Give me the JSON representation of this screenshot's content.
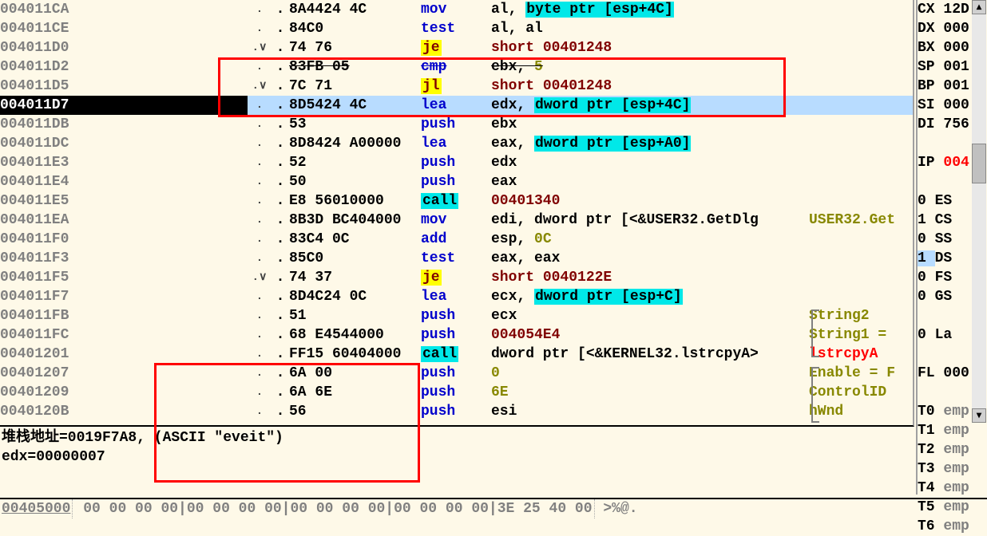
{
  "rows": [
    {
      "addr": "004011CA",
      "hint": ".",
      "bytes": "8A4424 4C",
      "mnem": "mov",
      "mnemCls": "tok-mnem-blue",
      "ops": [
        {
          "t": "al, ",
          "c": "tok-reg"
        },
        {
          "t": "byte ptr [esp+4C]",
          "c": "tok-ptr"
        }
      ]
    },
    {
      "addr": "004011CE",
      "hint": ".",
      "bytes": "84C0",
      "mnem": "test",
      "mnemCls": "tok-mnem-blue",
      "ops": [
        {
          "t": "al, al",
          "c": "tok-reg"
        }
      ]
    },
    {
      "addr": "004011D0",
      "hint": ".∨",
      "bytes": "74 76",
      "mnem": "je",
      "mnemCls": "tok-mnem-je",
      "ops": [
        {
          "t": "short ",
          "c": "tok-addr"
        },
        {
          "t": "00401248",
          "c": "tok-addr"
        }
      ]
    },
    {
      "addr": "004011D2",
      "hint": ".",
      "bytes": "83FB 05",
      "mnem": "cmp",
      "mnemCls": "tok-mnem-blue",
      "strike": true,
      "ops": [
        {
          "t": "ebx, ",
          "c": "tok-reg"
        },
        {
          "t": "5",
          "c": "tok-num"
        }
      ]
    },
    {
      "addr": "004011D5",
      "hint": ".∨",
      "bytes": "7C 71",
      "mnem": "jl",
      "mnemCls": "tok-mnem-je",
      "ops": [
        {
          "t": "short ",
          "c": "tok-addr"
        },
        {
          "t": "00401248",
          "c": "tok-addr"
        }
      ]
    },
    {
      "addr": "004011D7",
      "hint": ".",
      "bytes": "8D5424 4C",
      "mnem": "lea",
      "mnemCls": "tok-mnem-blue",
      "selected": true,
      "highlight": true,
      "ops": [
        {
          "t": "edx, ",
          "c": "tok-reg"
        },
        {
          "t": "dword ptr [esp+4C]",
          "c": "tok-ptr"
        }
      ]
    },
    {
      "addr": "004011DB",
      "hint": ".",
      "bytes": "53",
      "mnem": "push",
      "mnemCls": "tok-mnem-blue",
      "ops": [
        {
          "t": "ebx",
          "c": "tok-reg"
        }
      ]
    },
    {
      "addr": "004011DC",
      "hint": ".",
      "bytes": "8D8424 A00000",
      "mnem": "lea",
      "mnemCls": "tok-mnem-blue",
      "ops": [
        {
          "t": "eax, ",
          "c": "tok-reg"
        },
        {
          "t": "dword ptr [esp+A0]",
          "c": "tok-ptr"
        }
      ]
    },
    {
      "addr": "004011E3",
      "hint": ".",
      "bytes": "52",
      "mnem": "push",
      "mnemCls": "tok-mnem-blue",
      "ops": [
        {
          "t": "edx",
          "c": "tok-reg"
        }
      ]
    },
    {
      "addr": "004011E4",
      "hint": ".",
      "bytes": "50",
      "mnem": "push",
      "mnemCls": "tok-mnem-blue",
      "ops": [
        {
          "t": "eax",
          "c": "tok-reg"
        }
      ]
    },
    {
      "addr": "004011E5",
      "hint": ".",
      "bytes": "E8 56010000",
      "mnem": "call",
      "mnemCls": "tok-mnem-call",
      "ops": [
        {
          "t": "00401340",
          "c": "tok-addr"
        }
      ]
    },
    {
      "addr": "004011EA",
      "hint": ".",
      "bytes": "8B3D BC404000",
      "mnem": "mov",
      "mnemCls": "tok-mnem-blue",
      "ops": [
        {
          "t": "edi, ",
          "c": "tok-reg"
        },
        {
          "t": "dword ptr [<&USER32.GetDlg",
          "c": "tok-reg"
        }
      ],
      "cmt": "USER32.Get",
      "cmtCls": "cmt-normal"
    },
    {
      "addr": "004011F0",
      "hint": ".",
      "bytes": "83C4 0C",
      "mnem": "add",
      "mnemCls": "tok-mnem-blue",
      "ops": [
        {
          "t": "esp, ",
          "c": "tok-reg"
        },
        {
          "t": "0C",
          "c": "tok-num"
        }
      ]
    },
    {
      "addr": "004011F3",
      "hint": ".",
      "bytes": "85C0",
      "mnem": "test",
      "mnemCls": "tok-mnem-blue",
      "ops": [
        {
          "t": "eax, eax",
          "c": "tok-reg"
        }
      ]
    },
    {
      "addr": "004011F5",
      "hint": ".∨",
      "bytes": "74 37",
      "mnem": "je",
      "mnemCls": "tok-mnem-je",
      "ops": [
        {
          "t": "short ",
          "c": "tok-addr"
        },
        {
          "t": "0040122E",
          "c": "tok-addr"
        }
      ]
    },
    {
      "addr": "004011F7",
      "hint": ".",
      "bytes": "8D4C24 0C",
      "mnem": "lea",
      "mnemCls": "tok-mnem-blue",
      "ops": [
        {
          "t": "ecx, ",
          "c": "tok-reg"
        },
        {
          "t": "dword ptr [esp+C]",
          "c": "tok-ptr"
        }
      ]
    },
    {
      "addr": "004011FB",
      "hint": ".",
      "bytes": "51",
      "mnem": "push",
      "mnemCls": "tok-mnem-blue",
      "ops": [
        {
          "t": "ecx",
          "c": "tok-reg"
        }
      ],
      "cmt": "String2",
      "cmtCls": "cmt-normal"
    },
    {
      "addr": "004011FC",
      "hint": ".",
      "bytes": "68 E4544000",
      "mnem": "push",
      "mnemCls": "tok-mnem-blue",
      "ops": [
        {
          "t": "004054E4",
          "c": "tok-addr"
        }
      ],
      "cmt": "String1 =",
      "cmtCls": "cmt-normal"
    },
    {
      "addr": "00401201",
      "hint": ".",
      "bytes": "FF15 60404000",
      "mnem": "call",
      "mnemCls": "tok-mnem-call",
      "ops": [
        {
          "t": "dword ptr [<&KERNEL32.lstrcpyA>",
          "c": "tok-reg"
        }
      ],
      "cmt": "lstrcpyA",
      "cmtCls": "cmt-red"
    },
    {
      "addr": "00401207",
      "hint": ".",
      "bytes": "6A 00",
      "mnem": "push",
      "mnemCls": "tok-mnem-blue",
      "ops": [
        {
          "t": "0",
          "c": "tok-num"
        }
      ],
      "cmt": "Enable = F",
      "cmtCls": "cmt-normal"
    },
    {
      "addr": "00401209",
      "hint": ".",
      "bytes": "6A 6E",
      "mnem": "push",
      "mnemCls": "tok-mnem-blue",
      "ops": [
        {
          "t": "6E",
          "c": "tok-num"
        }
      ],
      "cmt": "ControlID",
      "cmtCls": "cmt-normal"
    },
    {
      "addr": "0040120B",
      "hint": ".",
      "bytes": "56",
      "mnem": "push",
      "mnemCls": "tok-mnem-blue",
      "ops": [
        {
          "t": "esi",
          "c": "tok-reg"
        }
      ],
      "cmt": "hWnd",
      "cmtCls": "cmt-normal"
    }
  ],
  "status": {
    "line1": "堆栈地址=0019F7A8, (ASCII \"eveit\")",
    "line2": "edx=00000007"
  },
  "hexbar": {
    "addr": "00405000",
    "bytes": "00 00 00 00|00 00 00 00|00 00 00 00|00 00 00 00|3E 25 40 00",
    "ascii": ">%@."
  },
  "registers": {
    "gp": [
      {
        "lbl": "CX",
        "val": "12D"
      },
      {
        "lbl": "DX",
        "val": "000"
      },
      {
        "lbl": "BX",
        "val": "000"
      },
      {
        "lbl": "SP",
        "val": "001"
      },
      {
        "lbl": "BP",
        "val": "001"
      },
      {
        "lbl": "SI",
        "val": "000"
      },
      {
        "lbl": "DI",
        "val": "756"
      }
    ],
    "ip": {
      "lbl": "IP",
      "val": "004"
    },
    "flags": [
      {
        "v": "0",
        "n": "ES"
      },
      {
        "v": "1",
        "n": "CS"
      },
      {
        "v": "0",
        "n": "SS"
      },
      {
        "v": "1",
        "n": "DS",
        "hl": true
      },
      {
        "v": "0",
        "n": "FS"
      },
      {
        "v": "0",
        "n": "GS"
      }
    ],
    "la": {
      "v": "0",
      "n": "La"
    },
    "fl": {
      "lbl": "FL",
      "val": "000"
    },
    "fpu": [
      {
        "n": "T0",
        "v": "emp"
      },
      {
        "n": "T1",
        "v": "emp"
      },
      {
        "n": "T2",
        "v": "emp"
      },
      {
        "n": "T3",
        "v": "emp"
      },
      {
        "n": "T4",
        "v": "emp"
      },
      {
        "n": "T5",
        "v": "emp"
      },
      {
        "n": "T6",
        "v": "emp"
      }
    ]
  }
}
